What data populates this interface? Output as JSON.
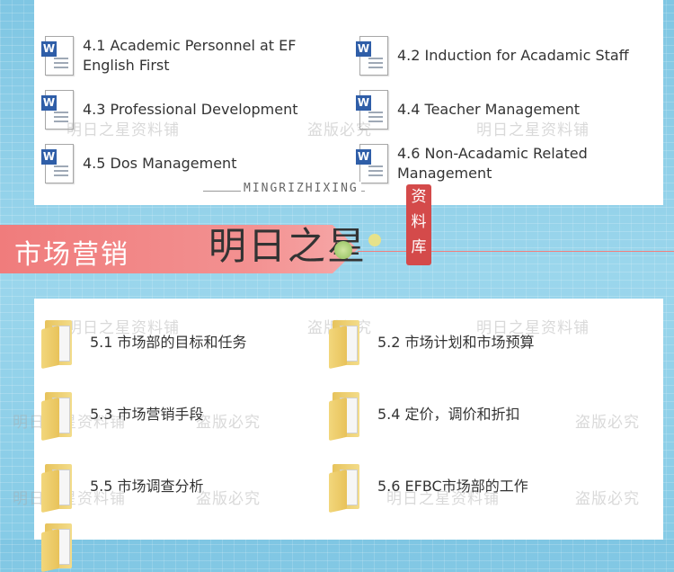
{
  "top_files": [
    {
      "label": "4.1 Academic Personnel at EF English First"
    },
    {
      "label": "4.2 Induction for Acadamic Staff"
    },
    {
      "label": "4.3 Professional Development"
    },
    {
      "label": "4.4 Teacher Management"
    },
    {
      "label": "4.5 Dos Management"
    },
    {
      "label": "4.6 Non-Acadamic Related Management"
    }
  ],
  "brand": {
    "english": "MINGRIZHIXING",
    "chinese": "明日之星",
    "seal": "资料库"
  },
  "section": {
    "title": "市场营销"
  },
  "bottom_folders": [
    {
      "label": "5.1 市场部的目标和任务"
    },
    {
      "label": "5.2 市场计划和市场预算"
    },
    {
      "label": "5.3 市场营销手段"
    },
    {
      "label": "5.4 定价，调价和折扣"
    },
    {
      "label": "5.5 市场调查分析"
    },
    {
      "label": "5.6 EFBC市场部的工作"
    }
  ],
  "watermarks": {
    "a": "明日之星资料铺",
    "b": "盗版必究"
  }
}
